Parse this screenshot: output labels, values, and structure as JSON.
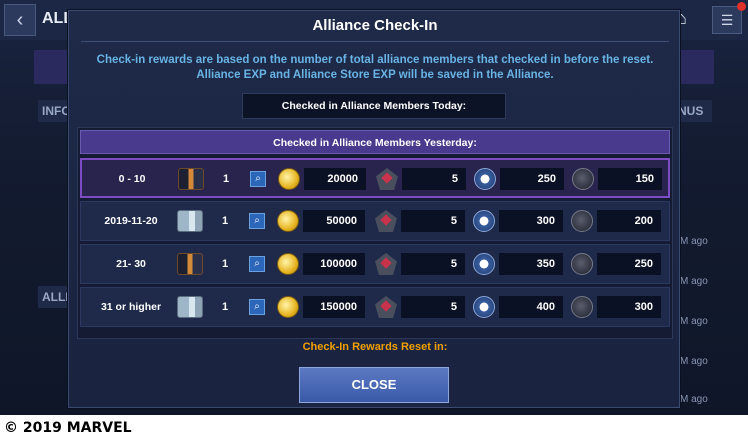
{
  "background": {
    "title": "ALLI",
    "info_tab": "INFO",
    "nus_tab": "NUS",
    "alli_tab": "ALLI",
    "ago_texts": [
      "M ago",
      "M ago",
      "M ago",
      "M ago",
      "M ago"
    ]
  },
  "modal": {
    "title": "Alliance Check-In",
    "description_line1": "Check-in rewards are based on the number of total alliance members that checked in before the reset.",
    "description_line2": "Alliance EXP and Alliance Store EXP will be saved in the Alliance.",
    "today_label": "Checked in Alliance Members Today:",
    "table_header": "Checked in Alliance Members Yesterday:",
    "rows": [
      {
        "range": "0 - 10",
        "crate_qty": "1",
        "gold": "20000",
        "shard_a": "5",
        "alliance_exp": "250",
        "store_exp": "150",
        "selected": true,
        "crate_style": "dark"
      },
      {
        "range": "2019-11-20",
        "crate_qty": "1",
        "gold": "50000",
        "shard_a": "5",
        "alliance_exp": "300",
        "store_exp": "200",
        "selected": false,
        "crate_style": "light"
      },
      {
        "range": "21- 30",
        "crate_qty": "1",
        "gold": "100000",
        "shard_a": "5",
        "alliance_exp": "350",
        "store_exp": "250",
        "selected": false,
        "crate_style": "dark"
      },
      {
        "range": "31 or higher",
        "crate_qty": "1",
        "gold": "150000",
        "shard_a": "5",
        "alliance_exp": "400",
        "store_exp": "300",
        "selected": false,
        "crate_style": "light"
      }
    ],
    "reset_label": "Check-In Rewards Reset in:",
    "close_label": "CLOSE"
  },
  "icons": {
    "crate": "crate-icon",
    "info": "magnify-icon",
    "gold": "gold-coin-icon",
    "shard": "pentagon-shard-icon",
    "alliance_exp": "alliance-badge-icon",
    "store": "store-shard-icon"
  },
  "colors": {
    "accent_purple": "#4a3a8e",
    "selected_border": "#7d4cc4",
    "description_text": "#69b4e6",
    "reset_text": "#f2a000",
    "close_button": "#3a5aa8"
  },
  "copyright": "© 2019 MARVEL"
}
